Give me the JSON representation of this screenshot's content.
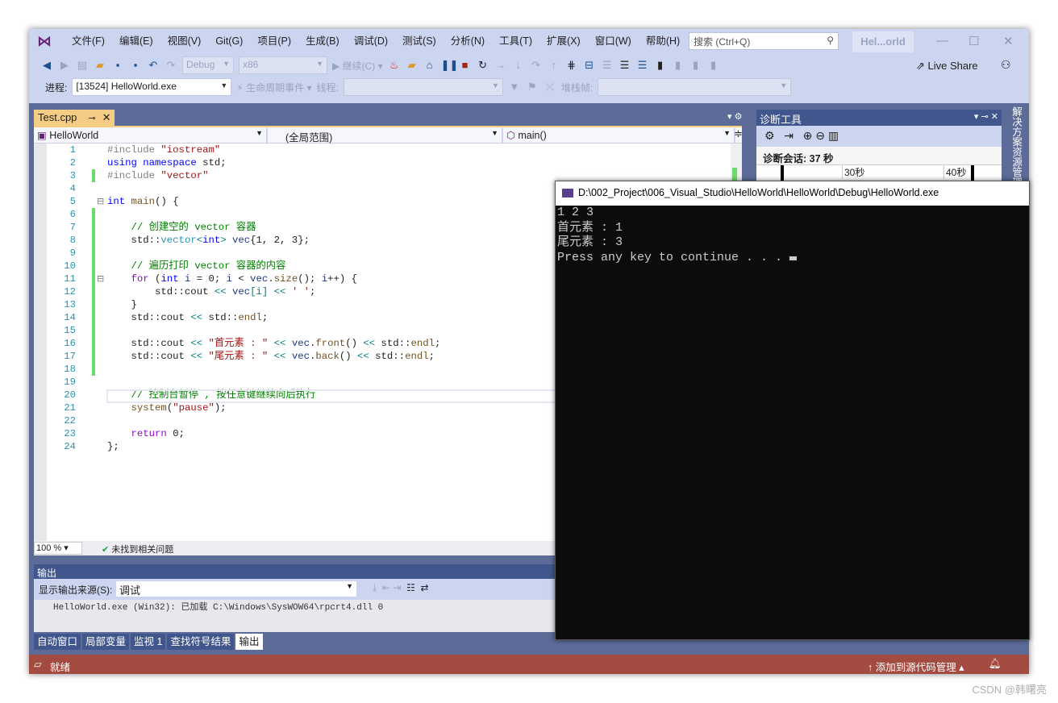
{
  "menu": [
    "文件(F)",
    "编辑(E)",
    "视图(V)",
    "Git(G)",
    "项目(P)",
    "生成(B)",
    "调试(D)",
    "测试(S)",
    "分析(N)",
    "工具(T)",
    "扩展(X)",
    "窗口(W)",
    "帮助(H)"
  ],
  "search_placeholder": "搜索 (Ctrl+Q)",
  "solution_title": "Hel...orld",
  "toolbar": {
    "config": "Debug",
    "platform": "x86",
    "continue": "继续(C)",
    "live_share": "Live Share"
  },
  "debugbar": {
    "process_label": "进程:",
    "process_value": "[13524] HelloWorld.exe",
    "lifecycle": "生命周期事件",
    "thread_label": "线程:",
    "stack_label": "堆栈帧:"
  },
  "editor": {
    "tab": "Test.cpp",
    "project": "HelloWorld",
    "scope": "(全局范围)",
    "member": "main()",
    "zoom": "100 %",
    "issues": "未找到相关问题",
    "changed_lines": [
      3,
      6,
      7,
      8,
      9,
      10,
      11,
      12,
      13,
      14,
      15,
      16,
      17,
      18
    ],
    "lines": [
      [
        [
          "pp",
          "#include "
        ],
        [
          "str",
          "\"iostream\""
        ]
      ],
      [
        [
          "kw",
          "using"
        ],
        [
          "pl",
          " "
        ],
        [
          "kw",
          "namespace"
        ],
        [
          "pl",
          " std;"
        ]
      ],
      [
        [
          "pp",
          "#include "
        ],
        [
          "str",
          "\"vector\""
        ]
      ],
      [],
      [
        [
          "kw",
          "int"
        ],
        [
          "pl",
          " "
        ],
        [
          "fn",
          "main"
        ],
        [
          "pl",
          "() {"
        ]
      ],
      [],
      [
        [
          "pl",
          "    "
        ],
        [
          "cm",
          "// 创建空的 vector 容器"
        ]
      ],
      [
        [
          "pl",
          "    std::"
        ],
        [
          "ty",
          "vector"
        ],
        [
          "op",
          "<"
        ],
        [
          "kw",
          "int"
        ],
        [
          "op",
          ">"
        ],
        [
          "pl",
          " "
        ],
        [
          "vr",
          "vec"
        ],
        [
          "pl",
          "{1, 2, 3};"
        ]
      ],
      [],
      [
        [
          "pl",
          "    "
        ],
        [
          "cm",
          "// 遍历打印 vector 容器的内容"
        ]
      ],
      [
        [
          "pl",
          "    "
        ],
        [
          "ct",
          "for"
        ],
        [
          "pl",
          " ("
        ],
        [
          "kw",
          "int"
        ],
        [
          "pl",
          " "
        ],
        [
          "vr",
          "i"
        ],
        [
          "pl",
          " = 0; "
        ],
        [
          "vr",
          "i"
        ],
        [
          "pl",
          " < "
        ],
        [
          "vr",
          "vec"
        ],
        [
          "pl",
          "."
        ],
        [
          "fn",
          "size"
        ],
        [
          "pl",
          "(); "
        ],
        [
          "vr",
          "i"
        ],
        [
          "pl",
          "++) {"
        ]
      ],
      [
        [
          "pl",
          "        std::cout "
        ],
        [
          "op",
          "<<"
        ],
        [
          "pl",
          " "
        ],
        [
          "vr",
          "vec"
        ],
        [
          "op",
          "[i]"
        ],
        [
          "pl",
          " "
        ],
        [
          "op",
          "<<"
        ],
        [
          "pl",
          " "
        ],
        [
          "str",
          "' '"
        ],
        [
          "pl",
          ";"
        ]
      ],
      [
        [
          "pl",
          "    }"
        ]
      ],
      [
        [
          "pl",
          "    std::cout "
        ],
        [
          "op",
          "<<"
        ],
        [
          "pl",
          " std::"
        ],
        [
          "fn",
          "endl"
        ],
        [
          "pl",
          ";"
        ]
      ],
      [],
      [
        [
          "pl",
          "    std::cout "
        ],
        [
          "op",
          "<<"
        ],
        [
          "pl",
          " "
        ],
        [
          "str",
          "\"首元素 : \""
        ],
        [
          "pl",
          " "
        ],
        [
          "op",
          "<<"
        ],
        [
          "pl",
          " "
        ],
        [
          "vr",
          "vec"
        ],
        [
          "pl",
          "."
        ],
        [
          "fn",
          "front"
        ],
        [
          "pl",
          "() "
        ],
        [
          "op",
          "<<"
        ],
        [
          "pl",
          " std::"
        ],
        [
          "fn",
          "endl"
        ],
        [
          "pl",
          ";"
        ]
      ],
      [
        [
          "pl",
          "    std::cout "
        ],
        [
          "op",
          "<<"
        ],
        [
          "pl",
          " "
        ],
        [
          "str",
          "\"尾元素 : \""
        ],
        [
          "pl",
          " "
        ],
        [
          "op",
          "<<"
        ],
        [
          "pl",
          " "
        ],
        [
          "vr",
          "vec"
        ],
        [
          "pl",
          "."
        ],
        [
          "fn",
          "back"
        ],
        [
          "pl",
          "() "
        ],
        [
          "op",
          "<<"
        ],
        [
          "pl",
          " std::"
        ],
        [
          "fn",
          "endl"
        ],
        [
          "pl",
          ";"
        ]
      ],
      [],
      [],
      [
        [
          "pl",
          "    "
        ],
        [
          "cm",
          "// 控制台暂停 , 按任意键继续向后执行"
        ]
      ],
      [
        [
          "pl",
          "    "
        ],
        [
          "fn",
          "system"
        ],
        [
          "pl",
          "("
        ],
        [
          "str",
          "\"pause\""
        ],
        [
          "pl",
          ");"
        ]
      ],
      [],
      [
        [
          "pl",
          "    "
        ],
        [
          "ct",
          "return"
        ],
        [
          "pl",
          " 0;"
        ]
      ],
      [
        [
          "pl",
          "};"
        ]
      ]
    ]
  },
  "diagnostics": {
    "title": "诊断工具",
    "session": "诊断会话: 37 秒",
    "tick1": "30秒",
    "tick2": "40秒"
  },
  "side_panel": "解决方案资源管理器",
  "output": {
    "title": "输出",
    "source_label": "显示输出来源(S):",
    "source_value": "调试",
    "text": "HelloWorld.exe (Win32): 已加载 C:\\Windows\\SysWOW64\\rpcrt4.dll  0"
  },
  "bottom_tabs": [
    "自动窗口",
    "局部变量",
    "监视 1",
    "查找符号结果",
    "输出"
  ],
  "status": {
    "ready": "就绪",
    "scm": "添加到源代码管理"
  },
  "console": {
    "title": "D:\\002_Project\\006_Visual_Studio\\HelloWorld\\HelloWorld\\Debug\\HelloWorld.exe",
    "lines": [
      "1 2 3",
      "首元素 : 1",
      "尾元素 : 3",
      "Press any key to continue . . . "
    ]
  },
  "watermark": "CSDN @韩曙亮"
}
